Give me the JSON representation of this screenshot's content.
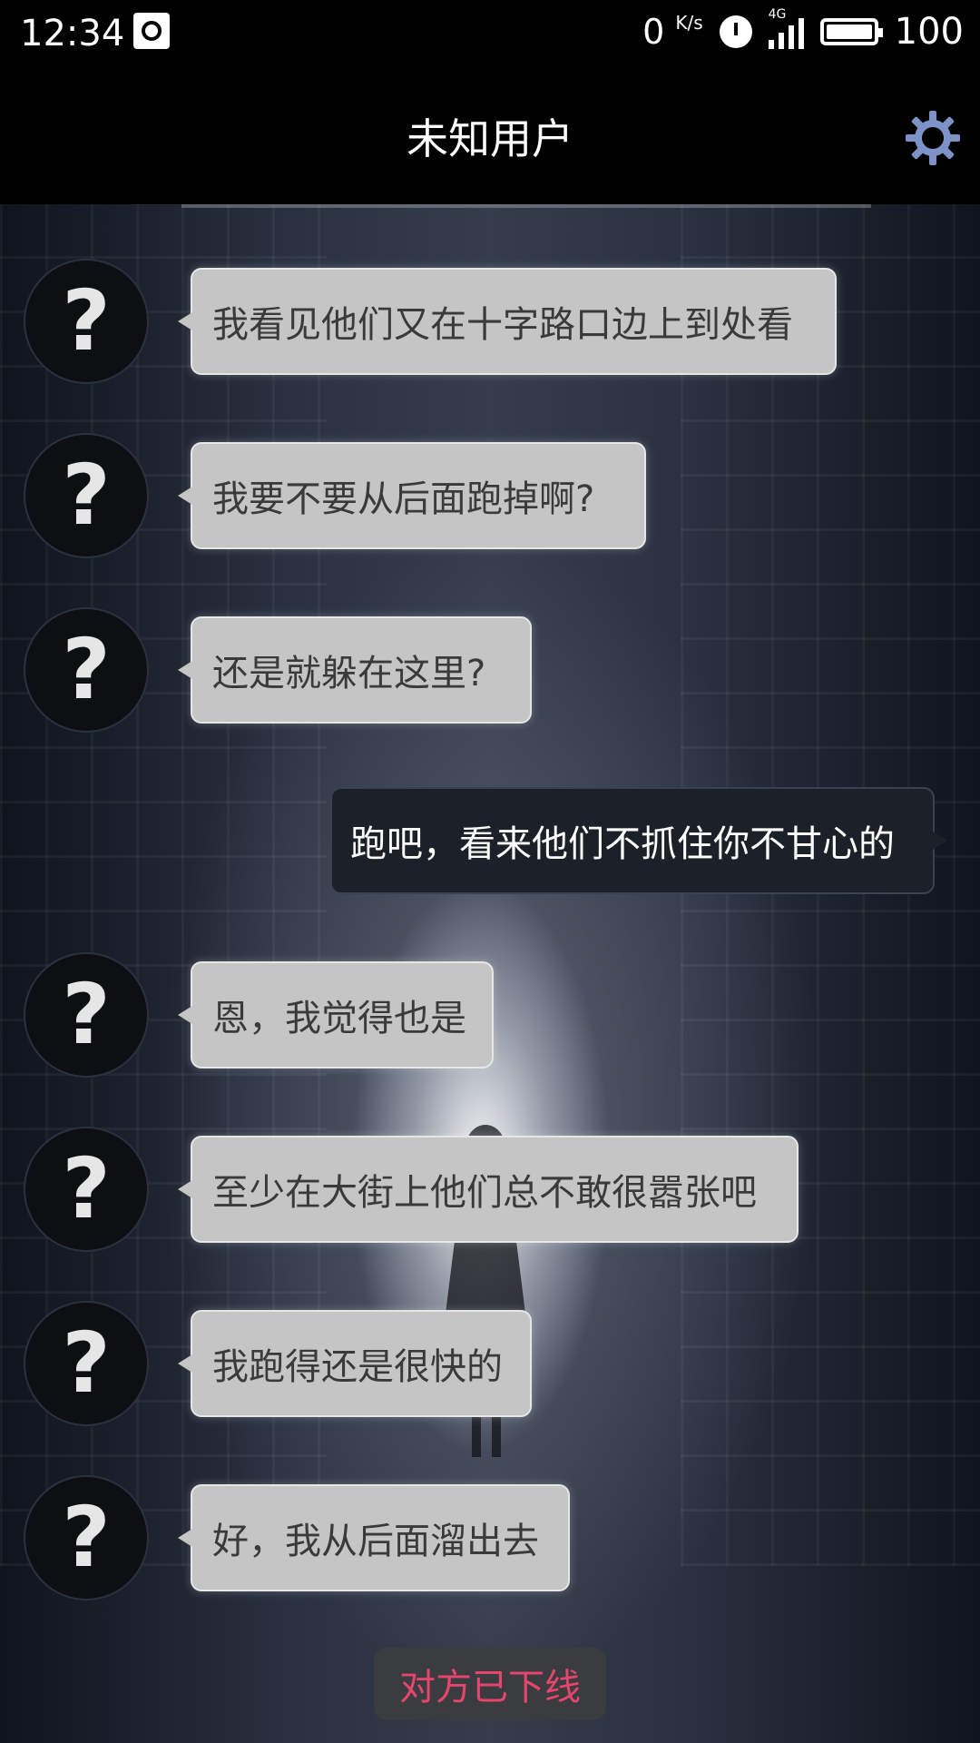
{
  "status_bar": {
    "time": "12:34",
    "net_speed": "0",
    "net_speed_unit": "K/s",
    "network_type": "4G",
    "battery": "100"
  },
  "header": {
    "title": "未知用户",
    "settings_icon": "gear-icon"
  },
  "avatar_glyph": "?",
  "messages": [
    {
      "side": "in",
      "text": "我看见他们又在十字路口边上到处看"
    },
    {
      "side": "in",
      "text": "我要不要从后面跑掉啊?"
    },
    {
      "side": "in",
      "text": "还是就躲在这里?"
    },
    {
      "side": "out",
      "text": "跑吧，看来他们不抓住你不甘心的"
    },
    {
      "side": "in",
      "text": "恩，我觉得也是"
    },
    {
      "side": "in",
      "text": "至少在大街上他们总不敢很嚣张吧"
    },
    {
      "side": "in",
      "text": "我跑得还是很快的"
    },
    {
      "side": "in",
      "text": "好，我从后面溜出去"
    }
  ],
  "footer": {
    "offline_label": "对方已下线"
  },
  "colors": {
    "offline_text": "#e7456c",
    "gear": "#7d93c7"
  }
}
